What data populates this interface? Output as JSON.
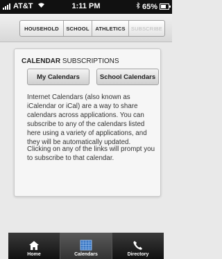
{
  "status_bar": {
    "carrier": "AT&T",
    "time": "1:11 PM",
    "battery": "65%"
  },
  "top_nav": {
    "tabs": [
      {
        "label": "HOUSEHOLD",
        "enabled": true
      },
      {
        "label": "SCHOOL",
        "enabled": true
      },
      {
        "label": "ATHLETICS",
        "enabled": true
      },
      {
        "label": "SUBSCRIBE",
        "enabled": false
      }
    ]
  },
  "card": {
    "title_bold": "CALENDAR",
    "title_rest": " SUBSCRIPTIONS",
    "buttons": {
      "my_calendars": "My Calendars",
      "school_calendars": "School Calendars"
    },
    "paragraph_1": "Internet Calendars (also known as iCalendar or iCal) are a way to share calendars across applications. You can subscribe to any of the calendars listed here using a variety of applications, and they will be automatically updated.",
    "paragraph_2": "Clicking on any of the links will prompt you to subscribe to that calendar."
  },
  "tab_bar": {
    "items": [
      {
        "label": "Home",
        "icon": "home-icon",
        "active": false
      },
      {
        "label": "Calendars",
        "icon": "calendar-icon",
        "active": true
      },
      {
        "label": "Directory",
        "icon": "phone-icon",
        "active": false
      }
    ]
  }
}
